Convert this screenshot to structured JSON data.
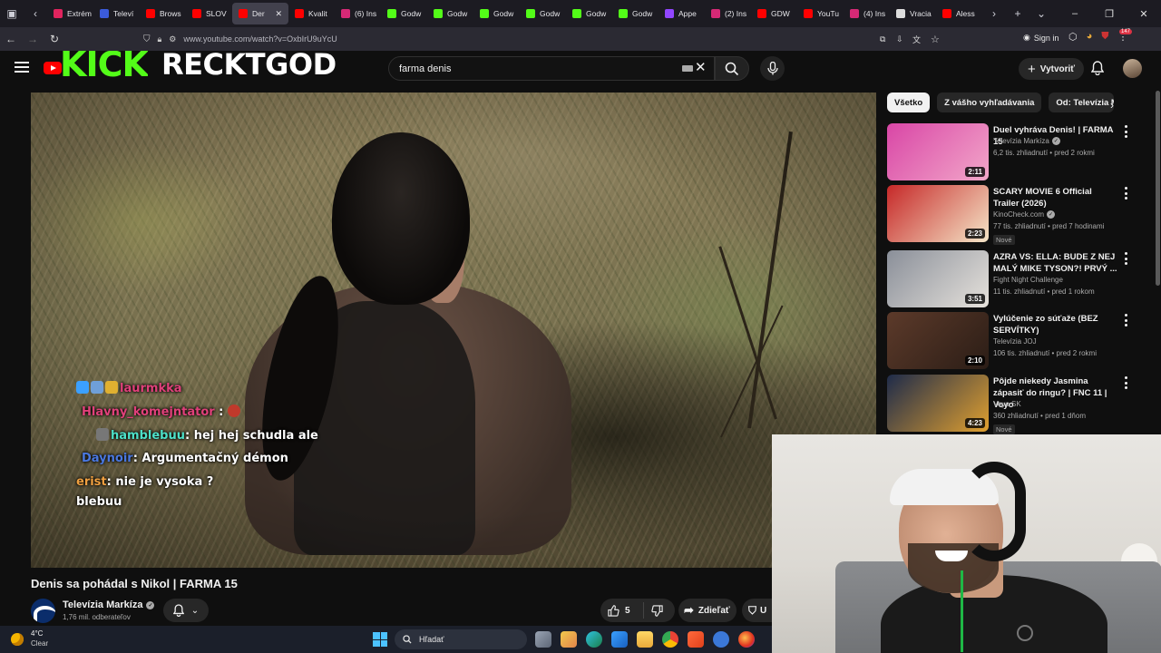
{
  "browser": {
    "tabs": [
      {
        "label": "Extrém",
        "favicon_color": "#e0245e",
        "active": false
      },
      {
        "label": "Televí",
        "favicon_color": "#3b5bdb",
        "active": false
      },
      {
        "label": "Brows",
        "favicon_color": "#ff0000",
        "active": false
      },
      {
        "label": "SLOV",
        "favicon_color": "#ff0000",
        "active": false
      },
      {
        "label": "Der",
        "favicon_color": "#ff0000",
        "active": true
      },
      {
        "label": "Kvalit",
        "favicon_color": "#ff0000",
        "active": false
      },
      {
        "label": "(6) Ins",
        "favicon_color": "#d62976",
        "active": false
      },
      {
        "label": "Godw",
        "favicon_color": "#53fc18",
        "active": false
      },
      {
        "label": "Godw",
        "favicon_color": "#53fc18",
        "active": false
      },
      {
        "label": "Godw",
        "favicon_color": "#53fc18",
        "active": false
      },
      {
        "label": "Godw",
        "favicon_color": "#53fc18",
        "active": false
      },
      {
        "label": "Godw",
        "favicon_color": "#53fc18",
        "active": false
      },
      {
        "label": "Godw",
        "favicon_color": "#53fc18",
        "active": false
      },
      {
        "label": "Appe",
        "favicon_color": "#9146ff",
        "active": false
      },
      {
        "label": "(2) Ins",
        "favicon_color": "#d62976",
        "active": false
      },
      {
        "label": "GDW",
        "favicon_color": "#ff0000",
        "active": false
      },
      {
        "label": "YouTu",
        "favicon_color": "#ff0000",
        "active": false
      },
      {
        "label": "(4) Ins",
        "favicon_color": "#d62976",
        "active": false
      },
      {
        "label": "Vracia",
        "favicon_color": "#dddddd",
        "active": false
      },
      {
        "label": "Aless",
        "favicon_color": "#ff0000",
        "active": false
      }
    ],
    "url": "www.youtube.com/watch?v=OxbIrU9uYcU",
    "sign_in": "Sign in",
    "badge": "147"
  },
  "youtube": {
    "overlay": {
      "kick": "KICK",
      "streamer": "RECKTGOD"
    },
    "search": {
      "value": "farma denis"
    },
    "create_label": "Vytvoriť",
    "video": {
      "title": "Denis sa pohádal s Nikol | FARMA 15",
      "channel": "Televízia Markíza",
      "subscribers": "1,76 mil. odberateľov",
      "likes": "5",
      "share_label": "Zdieľať",
      "save_label": "U"
    },
    "chat": [
      {
        "user": "laurmkka",
        "user_color": "#e0407a",
        "msg": ""
      },
      {
        "user": "Hlavny_komejntator",
        "user_color": "#e0407a",
        "msg": ""
      },
      {
        "user": "hamblebuu",
        "user_color": "#4de0c8",
        "msg": ": hej hej schudla ale"
      },
      {
        "user": "Daynoir",
        "user_color": "#4a78e0",
        "msg": ": Argumentačný démon"
      },
      {
        "user": "erist",
        "user_color": "#f0a040",
        "msg": ": nie je vysoka ?"
      },
      {
        "user": "",
        "user_color": "#ffffff",
        "msg": "blebuu"
      }
    ],
    "chips": [
      "Všetko",
      "Z vášho vyhľadávania",
      "Od: Televízia M"
    ],
    "recommendations": [
      {
        "title": "Duel vyhráva Denis! | FARMA 15",
        "channel": "Televízia Markíza",
        "verified": true,
        "views": "6,2 tis. zhliadnutí",
        "age": "pred 2 rokmi",
        "duration": "2:11",
        "new": false,
        "thumb_colors": [
          "#d946a6",
          "#f2a7c9"
        ]
      },
      {
        "title": "SCARY MOVIE 6 Official Trailer (2026)",
        "channel": "KinoCheck.com",
        "verified": true,
        "views": "77 tis. zhliadnutí",
        "age": "pred 7 hodinami",
        "duration": "2:23",
        "new": true,
        "new_label": "Nové",
        "thumb_colors": [
          "#c62828",
          "#f5e6c8"
        ]
      },
      {
        "title": "AZRA VS: ELLA: BUDE Z NEJ MALÝ MIKE TYSON?! PRVÝ ...",
        "channel": "Fight Night Challenge",
        "verified": false,
        "views": "11 tis. zhliadnutí",
        "age": "pred 1 rokom",
        "duration": "3:51",
        "new": false,
        "thumb_colors": [
          "#8a8f99",
          "#e6e2dc"
        ]
      },
      {
        "title": "Vylúčenie zo súťaže (BEZ SERVÍTKY)",
        "channel": "Televízia JOJ",
        "verified": false,
        "views": "106 tis. zhliadnutí",
        "age": "pred 2 rokmi",
        "duration": "2:10",
        "new": false,
        "thumb_colors": [
          "#5c3a2a",
          "#2b1d16"
        ]
      },
      {
        "title": "Pôjde niekedy Jasmina zápasiť do ringu? | FNC 11 | Voyo",
        "channel": "Voyo SK",
        "verified": false,
        "views": "360 zhliadnutí",
        "age": "pred 1 dňom",
        "duration": "4:23",
        "new": true,
        "new_label": "Nové",
        "thumb_colors": [
          "#1e2b4a",
          "#e0a030"
        ]
      }
    ]
  },
  "taskbar": {
    "temp": "4°C",
    "weather": "Clear",
    "search": "Hľadať"
  },
  "colors": {
    "accent_red": "#ff0000",
    "kick_green": "#53fc18",
    "bg": "#0f0f0f"
  }
}
